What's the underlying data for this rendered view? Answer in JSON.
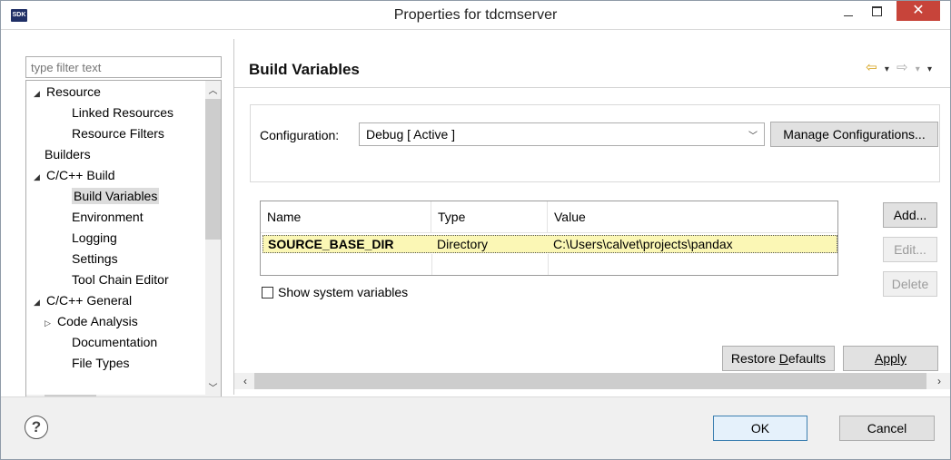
{
  "window": {
    "title": "Properties for tdcmserver",
    "app_icon_text": "SDK",
    "minimize_glyph": "–",
    "close_glyph": "✕"
  },
  "left": {
    "filter_placeholder": "type filter text",
    "tree": [
      {
        "label": "Resource",
        "indent": 0,
        "twisty": "expanded"
      },
      {
        "label": "Linked Resources",
        "indent": 2
      },
      {
        "label": "Resource Filters",
        "indent": 2
      },
      {
        "label": "Builders",
        "indent": 1
      },
      {
        "label": "C/C++ Build",
        "indent": 0,
        "twisty": "expanded"
      },
      {
        "label": "Build Variables",
        "indent": 2,
        "selected": true
      },
      {
        "label": "Environment",
        "indent": 2
      },
      {
        "label": "Logging",
        "indent": 2
      },
      {
        "label": "Settings",
        "indent": 2
      },
      {
        "label": "Tool Chain Editor",
        "indent": 2
      },
      {
        "label": "C/C++ General",
        "indent": 0,
        "twisty": "expanded"
      },
      {
        "label": "Code Analysis",
        "indent": 1,
        "twisty": "collapsed"
      },
      {
        "label": "Documentation",
        "indent": 2
      },
      {
        "label": "File Types",
        "indent": 2
      }
    ]
  },
  "right": {
    "title": "Build Variables",
    "nav": {
      "back": "⇦",
      "forward": "⇨",
      "dropdown": "▾",
      "menu": "▾"
    },
    "configuration": {
      "label": "Configuration:",
      "value": "Debug  [ Active ]",
      "manage_button": "Manage Configurations..."
    },
    "table": {
      "columns": [
        "Name",
        "Type",
        "Value"
      ],
      "rows": [
        {
          "name": "SOURCE_BASE_DIR",
          "type": "Directory",
          "value": "C:\\Users\\calvet\\projects\\pandax"
        }
      ]
    },
    "buttons": {
      "add": "Add...",
      "edit": "Edit...",
      "delete": "Delete"
    },
    "show_system_variables": {
      "label": "Show system variables",
      "checked": false
    },
    "restore_defaults": "Restore Defaults",
    "apply": "Apply"
  },
  "footer": {
    "help": "?",
    "ok": "OK",
    "cancel": "Cancel"
  },
  "colors": {
    "close_button": "#c7443a",
    "selected_row": "#fbf7b5",
    "back_arrow": "#d4a017"
  }
}
